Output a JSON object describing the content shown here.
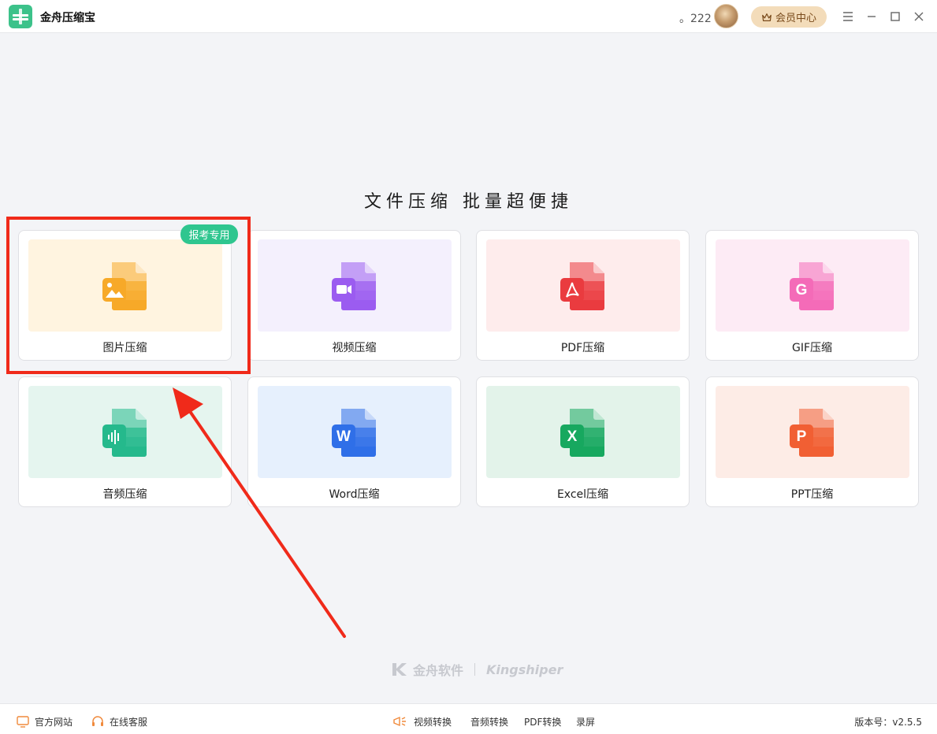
{
  "app": {
    "title": "金舟压缩宝"
  },
  "titlebar": {
    "user_count": "。222",
    "vip_label": "会员中心"
  },
  "main": {
    "heading": "文件压缩  批量超便捷",
    "badge": "报考专用",
    "cards": [
      {
        "label": "图片压缩",
        "icon": "image-file-icon",
        "color": "#f7a928",
        "bg": "#fff4e0"
      },
      {
        "label": "视频压缩",
        "icon": "video-file-icon",
        "color": "#9b5cf0",
        "bg": "#f4f0fd"
      },
      {
        "label": "PDF压缩",
        "icon": "pdf-file-icon",
        "color": "#ea3b3f",
        "bg": "#feecec"
      },
      {
        "label": "GIF压缩",
        "icon": "gif-file-icon",
        "color": "#f46bb8",
        "bg": "#fdebf5"
      },
      {
        "label": "音频压缩",
        "icon": "audio-file-icon",
        "color": "#25b98c",
        "bg": "#e5f5ef"
      },
      {
        "label": "Word压缩",
        "icon": "word-file-icon",
        "color": "#2f6fe8",
        "bg": "#e6f0fd"
      },
      {
        "label": "Excel压缩",
        "icon": "excel-file-icon",
        "color": "#17a85f",
        "bg": "#e3f3ea"
      },
      {
        "label": "PPT压缩",
        "icon": "ppt-file-icon",
        "color": "#f15f33",
        "bg": "#fdece6"
      }
    ],
    "glyphs": [
      "",
      "",
      "",
      "G",
      "",
      "W",
      "X",
      "P"
    ]
  },
  "watermark": {
    "cn": "金舟软件",
    "en": "Kingshiper"
  },
  "bottombar": {
    "website": "官方网站",
    "service": "在线客服",
    "video_convert": "视频转换",
    "audio_convert": "音频转换",
    "pdf_convert": "PDF转换",
    "record": "录屏",
    "version": "版本号：v2.5.5"
  },
  "colors": {
    "accent_green": "#2fc68f",
    "highlight_red": "#f02a1a",
    "vip_bg": "#f3dcba"
  }
}
